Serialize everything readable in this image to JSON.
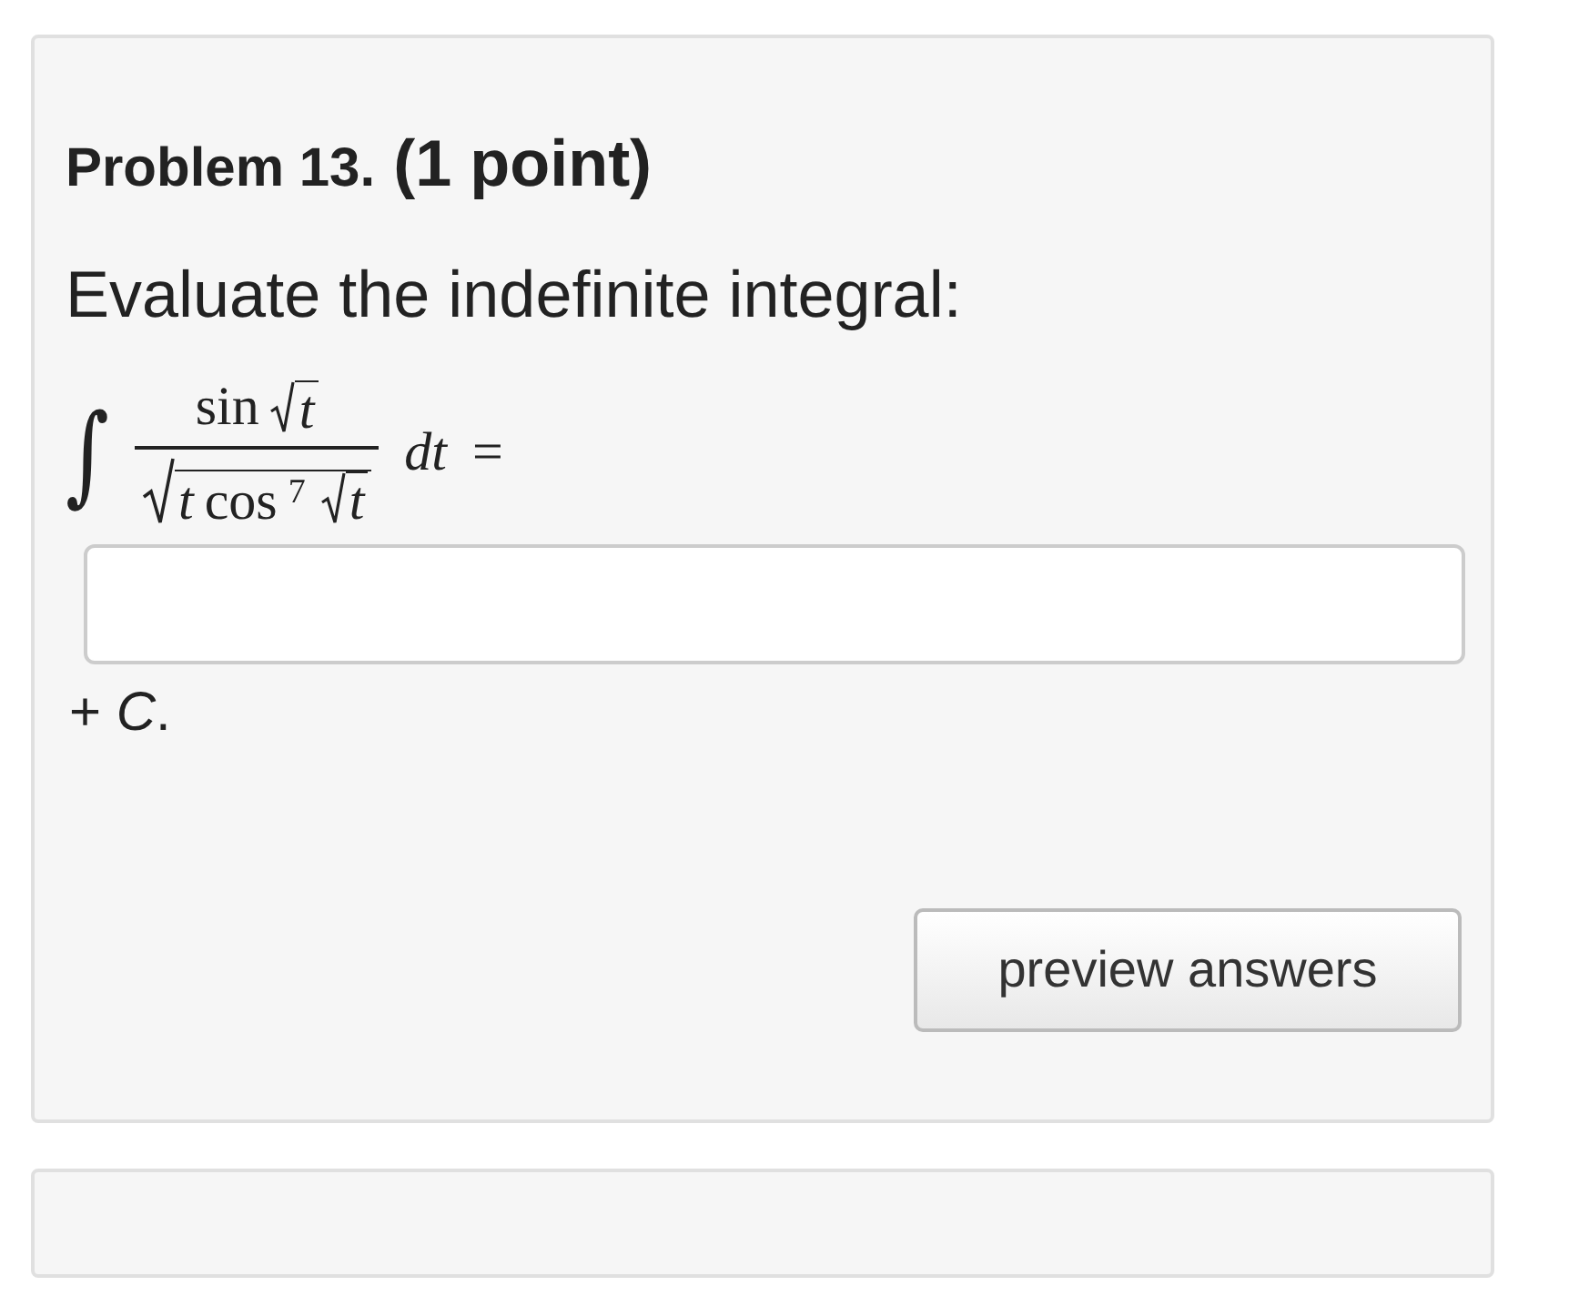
{
  "problem": {
    "number_label": "Problem 13.",
    "points": "(1 point)"
  },
  "prompt": "Evaluate the indefinite integral:",
  "formula": {
    "integral": "∫",
    "numerator": {
      "func": "sin",
      "radicand": "t"
    },
    "denominator": {
      "var": "t",
      "func": "cos",
      "power": "7",
      "radicand": "t"
    },
    "differential": "dt",
    "equals": "="
  },
  "suffix": "+ *C*.",
  "buttons": [
    {
      "label": "preview answers"
    }
  ]
}
